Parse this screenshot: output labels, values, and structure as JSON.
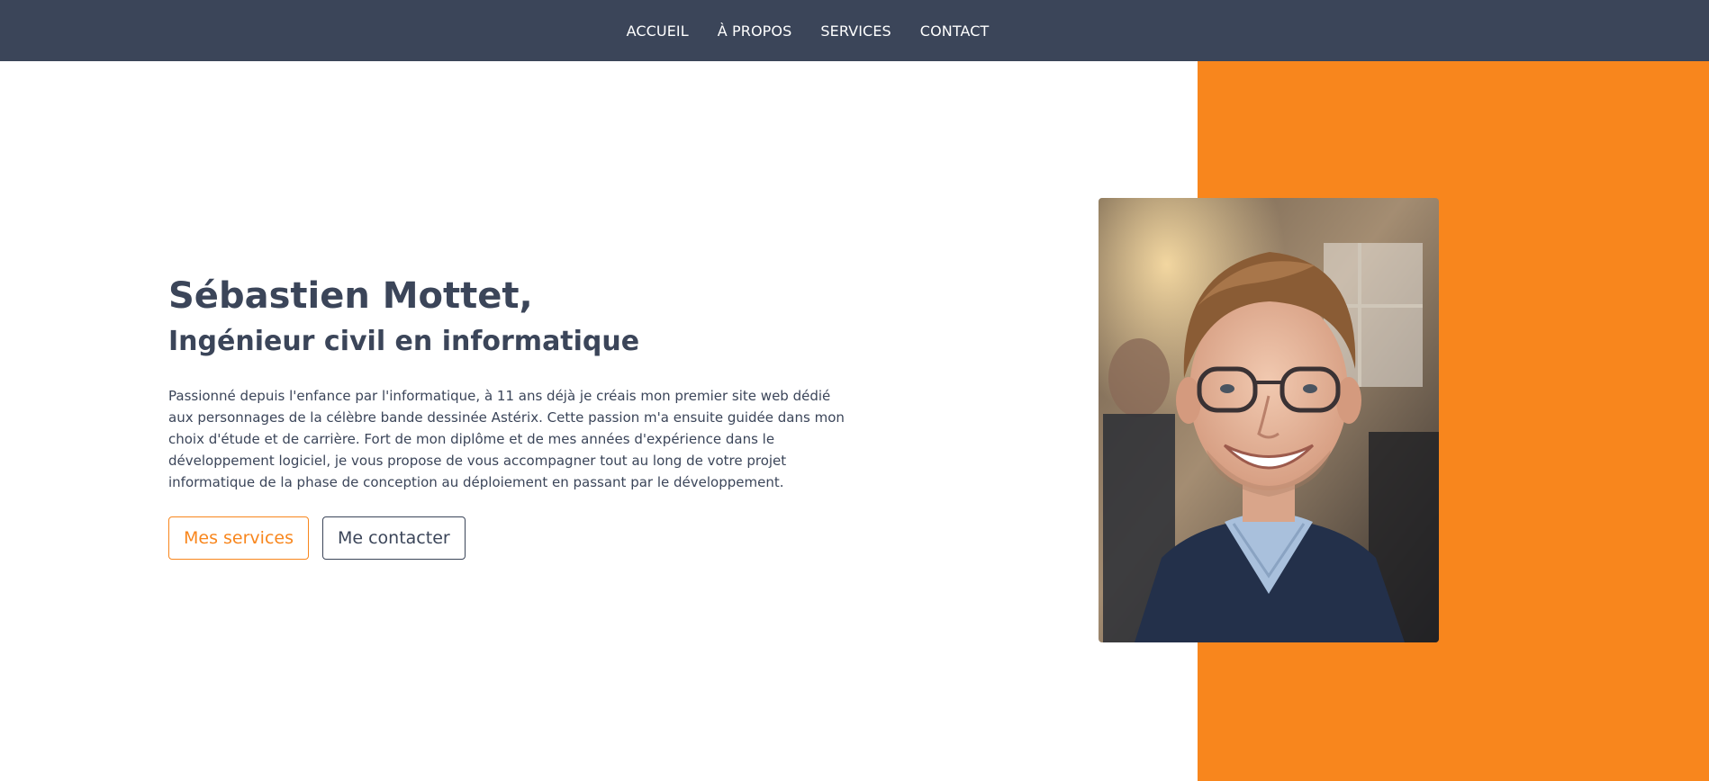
{
  "nav": {
    "items": [
      {
        "label": "ACCUEIL"
      },
      {
        "label": "À PROPOS"
      },
      {
        "label": "SERVICES"
      },
      {
        "label": "CONTACT"
      }
    ]
  },
  "hero": {
    "title": "Sébastien Mottet,",
    "subtitle": "Ingénieur civil en informatique",
    "paragraph": "Passionné depuis l'enfance par l'informatique, à 11 ans déjà je créais mon premier site web dédié aux personnages de la célèbre bande dessinée Astérix. Cette passion m'a ensuite guidée dans mon choix d'étude et de carrière. Fort de mon diplôme et de mes années d'expérience dans le développement logiciel, je vous propose de vous accompagner tout au long de votre projet informatique de la phase de conception au déploiement en passant par le développement.",
    "buttons": {
      "services_label": "Mes services",
      "contact_label": "Me contacter"
    }
  },
  "colors": {
    "navbar": "#3b4559",
    "accent": "#f8861d",
    "text": "#3b4559",
    "background": "#ffffff"
  }
}
